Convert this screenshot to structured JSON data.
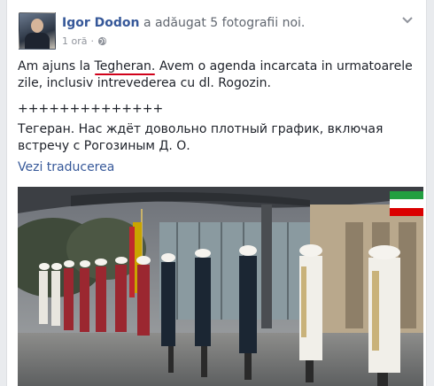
{
  "post": {
    "author": "Igor Dodon",
    "action": "a adăugat 5 fotografii noi.",
    "time": "1 oră",
    "privacy_icon": "globe-icon",
    "menu_icon": "chevron-down-icon",
    "text_ro_before": "Am ajuns la ",
    "text_ro_highlight": "Tegheran.",
    "text_ro_after": " Avem o agenda incarcata in urmatoarele zile, inclusiv intrevederea cu dl. Rogozin.",
    "separator": "++++++++++++++",
    "text_ru": "Тегеран. Нас ждёт довольно плотный график, включая встречу с Рогозиным Д. О.",
    "see_translation": "Vezi traducerea",
    "colors": {
      "link": "#365899",
      "meta": "#90949c",
      "highlight_underline": "#d0021b"
    }
  }
}
